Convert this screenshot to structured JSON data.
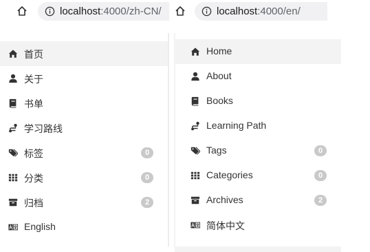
{
  "left": {
    "url_host": "localhost",
    "url_rest": ":4000/zh-CN/",
    "nav": [
      {
        "label": "首页",
        "icon": "home-icon",
        "active": true,
        "count": null
      },
      {
        "label": "关于",
        "icon": "user-icon",
        "active": false,
        "count": null
      },
      {
        "label": "书单",
        "icon": "book-icon",
        "active": false,
        "count": null
      },
      {
        "label": "学习路线",
        "icon": "route-icon",
        "active": false,
        "count": null
      },
      {
        "label": "标签",
        "icon": "tags-icon",
        "active": false,
        "count": "0"
      },
      {
        "label": "分类",
        "icon": "grid-icon",
        "active": false,
        "count": "0"
      },
      {
        "label": "归档",
        "icon": "archive-icon",
        "active": false,
        "count": "2"
      },
      {
        "label": "English",
        "icon": "language-icon",
        "active": false,
        "count": null
      }
    ]
  },
  "right": {
    "url_host": "localhost",
    "url_rest": ":4000/en/",
    "nav": [
      {
        "label": "Home",
        "icon": "home-icon",
        "active": true,
        "count": null
      },
      {
        "label": "About",
        "icon": "user-icon",
        "active": false,
        "count": null
      },
      {
        "label": "Books",
        "icon": "book-icon",
        "active": false,
        "count": null
      },
      {
        "label": "Learning Path",
        "icon": "route-icon",
        "active": false,
        "count": null
      },
      {
        "label": "Tags",
        "icon": "tags-icon",
        "active": false,
        "count": "0"
      },
      {
        "label": "Categories",
        "icon": "grid-icon",
        "active": false,
        "count": "0"
      },
      {
        "label": "Archives",
        "icon": "archive-icon",
        "active": false,
        "count": "2"
      },
      {
        "label": "简体中文",
        "icon": "language-icon",
        "active": false,
        "count": null
      }
    ]
  },
  "colors": {
    "active_bg": "#f3f3f3",
    "badge_bg": "#c9c9c9",
    "text": "#333333",
    "url_pill": "#f1f1f3"
  }
}
